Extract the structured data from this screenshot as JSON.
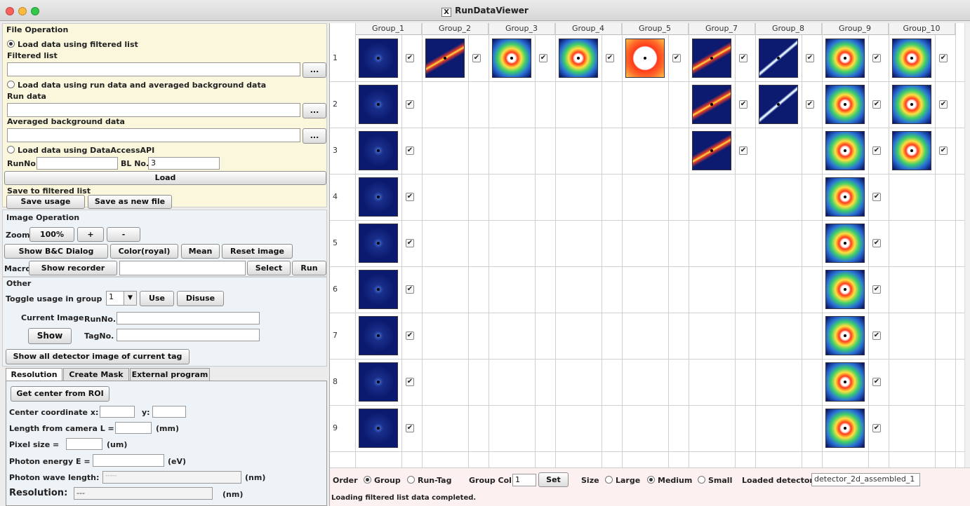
{
  "window": {
    "title": "RunDataViewer"
  },
  "file_operation": {
    "section_title": "File Operation",
    "opt_filtered": "Load data using filtered list",
    "filtered_list_label": "Filtered list",
    "filtered_list_value": "",
    "browse_label": "...",
    "opt_run": "Load data using run data and averaged background data",
    "run_data_label": "Run data",
    "avg_bg_label": "Averaged background data",
    "opt_api": "Load data using DataAccessAPI",
    "runno_label": "RunNo.",
    "runno_value": "",
    "blno_label": "BL No.",
    "blno_value": "3",
    "load_button": "Load",
    "save_title": "Save to filtered list",
    "save_usage": "Save usage",
    "save_new_file": "Save as new file"
  },
  "image_operation": {
    "section_title": "Image Operation",
    "zoom_label": "Zoom",
    "zoom_value": "100%",
    "zoom_in": "+",
    "zoom_out": "-",
    "show_bc": "Show B&C Dialog",
    "color": "Color(royal)",
    "mean": "Mean",
    "reset": "Reset image",
    "macro_label": "Macro",
    "show_recorder": "Show recorder",
    "macro_value": "",
    "select": "Select",
    "run": "Run"
  },
  "other": {
    "section_title": "Other",
    "toggle_label": "Toggle usage in group",
    "group_value": "1",
    "use": "Use",
    "disuse": "Disuse",
    "current_image": "Current Image",
    "runno_label": "RunNo.",
    "show": "Show",
    "tagno_label": "TagNo.",
    "show_all": "Show all detector image of current tag"
  },
  "tabs": [
    "Resolution",
    "Create Mask",
    "External program"
  ],
  "resolution": {
    "get_center": "Get center from ROI",
    "center_label": "Center coordinate x:",
    "y_label": "y:",
    "length_label": "Length from camera L =",
    "length_unit": "(mm)",
    "pixel_label": "Pixel size =",
    "pixel_unit": "(um)",
    "energy_label": "Photon energy E =",
    "energy_unit": "(eV)",
    "wave_label": "Photon wave length:",
    "wave_value": "-----",
    "wave_unit": "(nm)",
    "res_label": "Resolution:",
    "res_value": "---",
    "res_unit": "(nm)"
  },
  "grid": {
    "columns": [
      "Group_1",
      "Group_2",
      "Group_3",
      "Group_4",
      "Group_5",
      "Group_7",
      "Group_8",
      "Group_9",
      "Group_10"
    ],
    "rows": [
      "1",
      "2",
      "3",
      "4",
      "5",
      "6",
      "7",
      "8",
      "9"
    ],
    "check_mark": "✔",
    "cells": [
      [
        1,
        1,
        1,
        1,
        1,
        1,
        1,
        1,
        1
      ],
      [
        1,
        0,
        0,
        0,
        0,
        1,
        1,
        1,
        1
      ],
      [
        1,
        0,
        0,
        0,
        0,
        1,
        0,
        1,
        1
      ],
      [
        1,
        0,
        0,
        0,
        0,
        0,
        0,
        1,
        0
      ],
      [
        1,
        0,
        0,
        0,
        0,
        0,
        0,
        1,
        0
      ],
      [
        1,
        0,
        0,
        0,
        0,
        0,
        0,
        1,
        0
      ],
      [
        1,
        0,
        0,
        0,
        0,
        0,
        0,
        1,
        0
      ],
      [
        1,
        0,
        0,
        0,
        0,
        0,
        0,
        1,
        0
      ],
      [
        1,
        0,
        0,
        0,
        0,
        0,
        0,
        1,
        0
      ]
    ],
    "pattern_types": [
      "faint",
      "streak",
      "ring",
      "ring",
      "disk",
      "streak",
      "line",
      "ring",
      "ring"
    ]
  },
  "bottom": {
    "order_label": "Order",
    "group": "Group",
    "runtag": "Run-Tag",
    "group_col_label": "Group Col",
    "group_col_value": "1",
    "set": "Set",
    "size_label": "Size",
    "large": "Large",
    "medium": "Medium",
    "small": "Small",
    "loaded_label": "Loaded detector:",
    "loaded_value": "detector_2d_assembled_1"
  },
  "status": "Loading filtered list data completed.",
  "colors": {
    "close": "#fc605c",
    "min": "#fdbc40",
    "max": "#34c84a",
    "accent": "#1a3a8f"
  }
}
